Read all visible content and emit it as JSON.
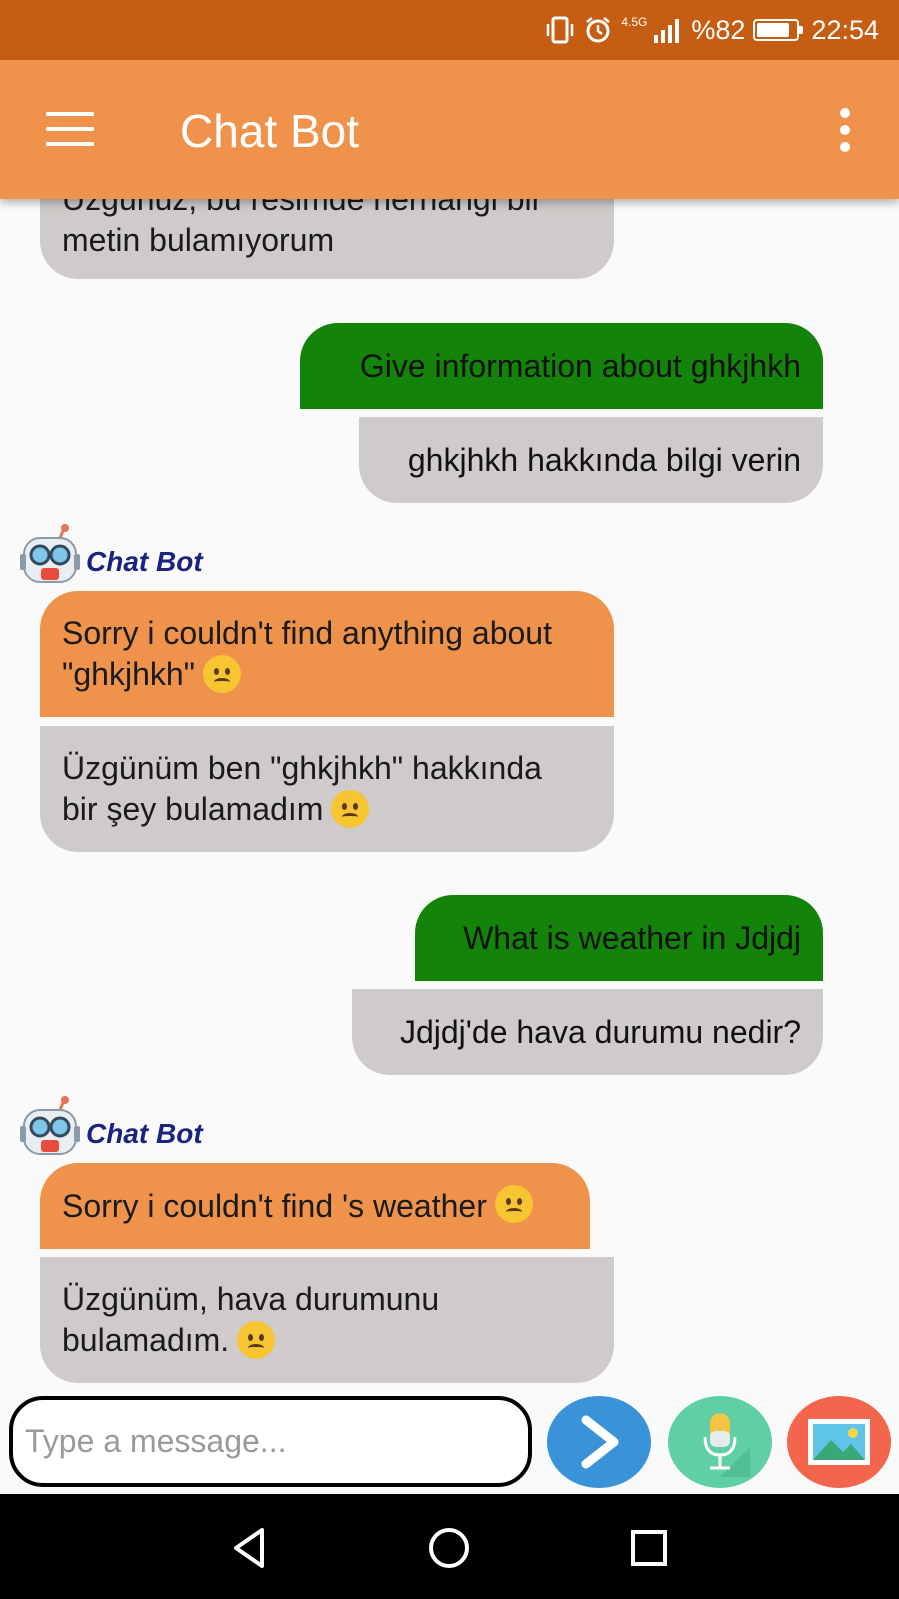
{
  "status_bar": {
    "network_type": "4.5G",
    "battery_text": "%82",
    "battery_level": 0.82,
    "time": "22:54",
    "icons": [
      "vibrate-icon",
      "alarm-icon",
      "signal-icon",
      "battery-icon"
    ]
  },
  "app_bar": {
    "title": "Chat Bot",
    "menu_icon": "hamburger-icon",
    "overflow_icon": "more-vert-icon"
  },
  "colors": {
    "status_bar": "#c55d13",
    "app_bar": "#ef934c",
    "bot_bubble": "#ef934c",
    "user_bubble": "#138309",
    "translation_bubble": "#cfcbca",
    "bot_name": "#1a237e",
    "send_button": "#3a93d8",
    "mic_button": "#5fcfa4",
    "image_button": "#f4654d"
  },
  "messages": [
    {
      "sender": "bot",
      "partial_top_text": "Üzgünüz, bu resimde herhangi bir",
      "translated_text": "metin bulamıyorum"
    },
    {
      "sender": "user",
      "text": "Give information about ghkjhkh",
      "translated_text": "ghkjhkh hakkında bilgi verin"
    },
    {
      "sender": "bot",
      "name": "Chat Bot",
      "text_line1": "Sorry i couldn't find anything about",
      "text_line2": "\"ghkjhkh\"",
      "translated_line1": "Üzgünüm ben \"ghkjhkh\" hakkında",
      "translated_line2": "bir şey bulamadım"
    },
    {
      "sender": "user",
      "text": "What is weather in Jdjdj",
      "translated_text": "Jdjdj'de hava durumu nedir?"
    },
    {
      "sender": "bot",
      "name": "Chat Bot",
      "text_line1": "Sorry i couldn't find 's weather",
      "translated_line1": "Üzgünüm, hava durumunu",
      "translated_line2": "bulamadım."
    }
  ],
  "composer": {
    "placeholder": "Type a message...",
    "value": "",
    "send_icon": "send-arrow-icon",
    "mic_icon": "microphone-icon",
    "image_icon": "image-gallery-icon"
  },
  "nav_bar": {
    "buttons": [
      "back-icon",
      "home-icon",
      "recents-icon"
    ]
  }
}
